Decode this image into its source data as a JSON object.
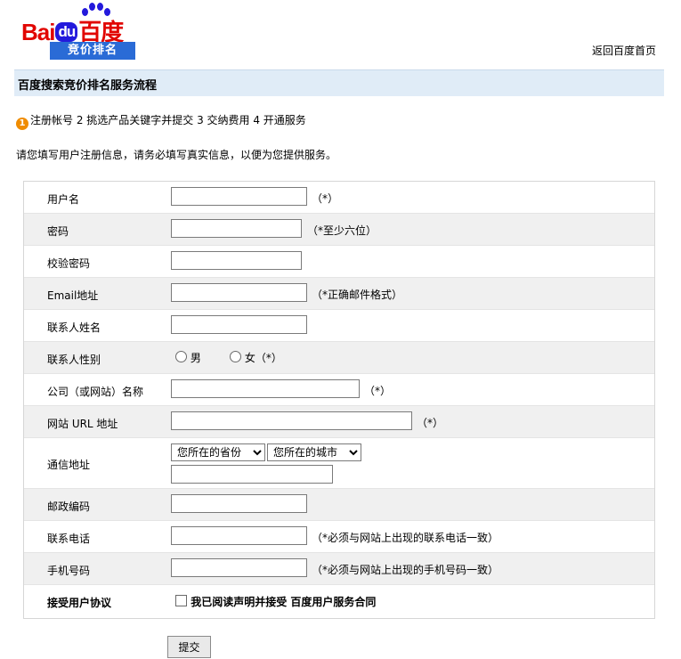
{
  "logo": {
    "wordmark_bai": "Bai",
    "wordmark_du": "du",
    "wordmark_cn": "百度",
    "tagline": "竞价排名"
  },
  "header": {
    "home_link": "返回百度首页"
  },
  "section_title": "百度搜索竞价排名服务流程",
  "steps": {
    "current_step_number": "1",
    "text": "注册帐号 2 挑选产品关键字并提交 3 交纳费用 4 开通服务"
  },
  "instruction": "请您填写用户注册信息，请务必填写真实信息，以便为您提供服务。",
  "form": {
    "username": {
      "label": "用户名",
      "value": "",
      "hint": "（*）"
    },
    "password": {
      "label": "密码",
      "value": "",
      "hint": "（*至少六位）"
    },
    "confirm_password": {
      "label": "校验密码",
      "value": ""
    },
    "email": {
      "label": "Email地址",
      "value": "",
      "hint": "（*正确邮件格式）"
    },
    "contact_name": {
      "label": "联系人姓名",
      "value": ""
    },
    "gender": {
      "label": "联系人性别",
      "male": "男",
      "female": "女",
      "hint": "（*）"
    },
    "company": {
      "label": "公司（或网站）名称",
      "value": "",
      "hint": "（*）"
    },
    "site_url": {
      "label": "网站 URL 地址",
      "value": "",
      "hint": "（*）"
    },
    "address": {
      "label": "通信地址",
      "province": "您所在的省份",
      "city": "您所在的城市",
      "value": ""
    },
    "postcode": {
      "label": "邮政编码",
      "value": ""
    },
    "phone": {
      "label": "联系电话",
      "value": "",
      "hint": "（*必须与网站上出现的联系电话一致）"
    },
    "mobile": {
      "label": "手机号码",
      "value": "",
      "hint": "（*必须与网站上出现的手机号码一致）"
    },
    "agreement": {
      "label": "接受用户协议",
      "checkbox_text": "我已阅读声明并接受 百度用户服务合同"
    }
  },
  "submit_label": "提交"
}
